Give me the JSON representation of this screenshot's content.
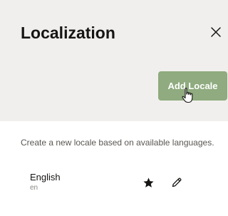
{
  "dialog": {
    "title": "Localization",
    "close_icon": "close-icon",
    "add_button_label": "Add Locale",
    "accent_color": "#8fab7f",
    "header_background": "#f1efed"
  },
  "content": {
    "description": "Create a new locale based on available languages."
  },
  "locales": [
    {
      "name": "English",
      "code": "en",
      "default_icon": "star-icon",
      "edit_icon": "pencil-icon"
    }
  ]
}
